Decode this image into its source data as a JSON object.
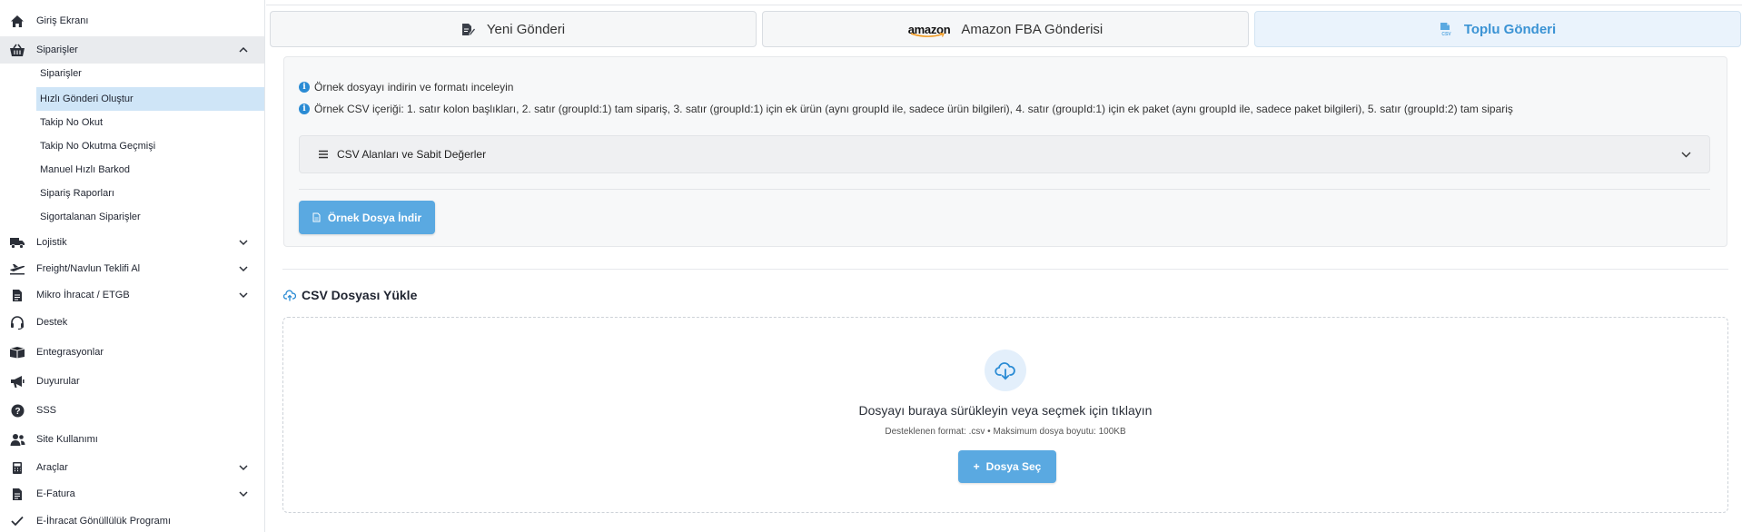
{
  "sidebar": {
    "items": [
      {
        "label": "Giriş Ekranı",
        "icon": "home-icon"
      },
      {
        "label": "Siparişler",
        "icon": "basket-icon",
        "expanded": true
      },
      {
        "label": "Lojistik",
        "icon": "truck-icon"
      },
      {
        "label": "Freight/Navlun Teklifi Al",
        "icon": "plane-icon"
      },
      {
        "label": "Mikro İhracat / ETGB",
        "icon": "document-icon"
      },
      {
        "label": "Destek",
        "icon": "headset-icon"
      },
      {
        "label": "Entegrasyonlar",
        "icon": "box-icon"
      },
      {
        "label": "Duyurular",
        "icon": "megaphone-icon"
      },
      {
        "label": "SSS",
        "icon": "question-icon"
      },
      {
        "label": "Site Kullanımı",
        "icon": "users-icon"
      },
      {
        "label": "Araçlar",
        "icon": "calculator-icon"
      },
      {
        "label": "E-Fatura",
        "icon": "invoice-icon"
      },
      {
        "label": "E-İhracat Gönüllülük Programı",
        "icon": "check-icon"
      }
    ],
    "subitems": [
      {
        "label": "Siparişler"
      },
      {
        "label": "Hızlı Gönderi Oluştur",
        "active": true
      },
      {
        "label": "Takip No Okut"
      },
      {
        "label": "Takip No Okutma Geçmişi"
      },
      {
        "label": "Manuel Hızlı Barkod"
      },
      {
        "label": "Sipariş Raporları"
      },
      {
        "label": "Sigortalanan Siparişler"
      }
    ]
  },
  "tabs": [
    {
      "label": "Yeni Gönderi",
      "icon": "edit-document-icon"
    },
    {
      "label": "Amazon FBA Gönderisi",
      "icon": "amazon-logo",
      "logo_text": "amazon"
    },
    {
      "label": "Toplu Gönderi",
      "icon": "csv-file-icon",
      "active": true
    }
  ],
  "info": {
    "line1": "Örnek dosyayı indirin ve formatı inceleyin",
    "line2": "Örnek CSV içeriği: 1. satır kolon başlıkları, 2. satır (groupId:1) tam sipariş, 3. satır (groupId:1) için ek ürün (aynı groupId ile, sadece ürün bilgileri), 4. satır (groupId:1) için ek paket (aynı groupId ile, sadece paket bilgileri), 5. satır (groupId:2) tam sipariş",
    "accordion_label": "CSV Alanları ve Sabit Değerler",
    "download_button": "Örnek Dosya İndir"
  },
  "upload": {
    "title": "CSV Dosyası Yükle",
    "drop_text": "Dosyayı buraya sürükleyin veya seçmek için tıklayın",
    "hint": "Desteklenen format: .csv • Maksimum dosya boyutu: 100KB",
    "choose_button": "Dosya Seç"
  },
  "colors": {
    "accent": "#5aa9e1",
    "active_tab_text": "#3a93d4",
    "active_subitem_bg": "#cfe5f7",
    "info_icon": "#2a8bd4"
  }
}
